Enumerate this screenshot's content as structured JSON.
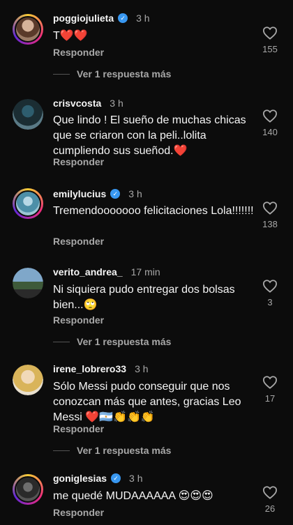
{
  "comments": [
    {
      "username": "poggiojulieta",
      "verified": true,
      "time": "3 h",
      "text": "T❤️❤️",
      "reply": "Responder",
      "likes": "155",
      "more": "Ver 1 respuesta más"
    },
    {
      "username": "crisvcosta",
      "verified": false,
      "time": "3 h",
      "text": "Que lindo ! El sueño de  muchas chicas que se criaron con la peli..lolita cumpliendo sus sueñod.❤️",
      "reply": "Responder",
      "likes": "140"
    },
    {
      "username": "emilylucius",
      "verified": true,
      "time": "3 h",
      "text": "Tremendooooooo felicitaciones Lola!!!!!!!",
      "reply": "Responder",
      "likes": "138"
    },
    {
      "username": "verito_andrea_",
      "verified": false,
      "time": "17 min",
      "text": "Ni siquiera pudo entregar dos bolsas bien...🙄",
      "reply": "Responder",
      "likes": "3",
      "more": "Ver 1 respuesta más"
    },
    {
      "username": "irene_lobrero33",
      "verified": false,
      "time": "3 h",
      "text": "Sólo Messi pudo conseguir que nos conozcan más que antes, gracias Leo Messi ❤️🇦🇷👏👏👏",
      "reply": "Responder",
      "likes": "17",
      "more": "Ver 1 respuesta más"
    },
    {
      "username": "goniglesias",
      "verified": true,
      "time": "3 h",
      "text": "me quedé MUDAAAAAA 😍😍😍",
      "reply": "Responder",
      "likes": "26"
    }
  ]
}
